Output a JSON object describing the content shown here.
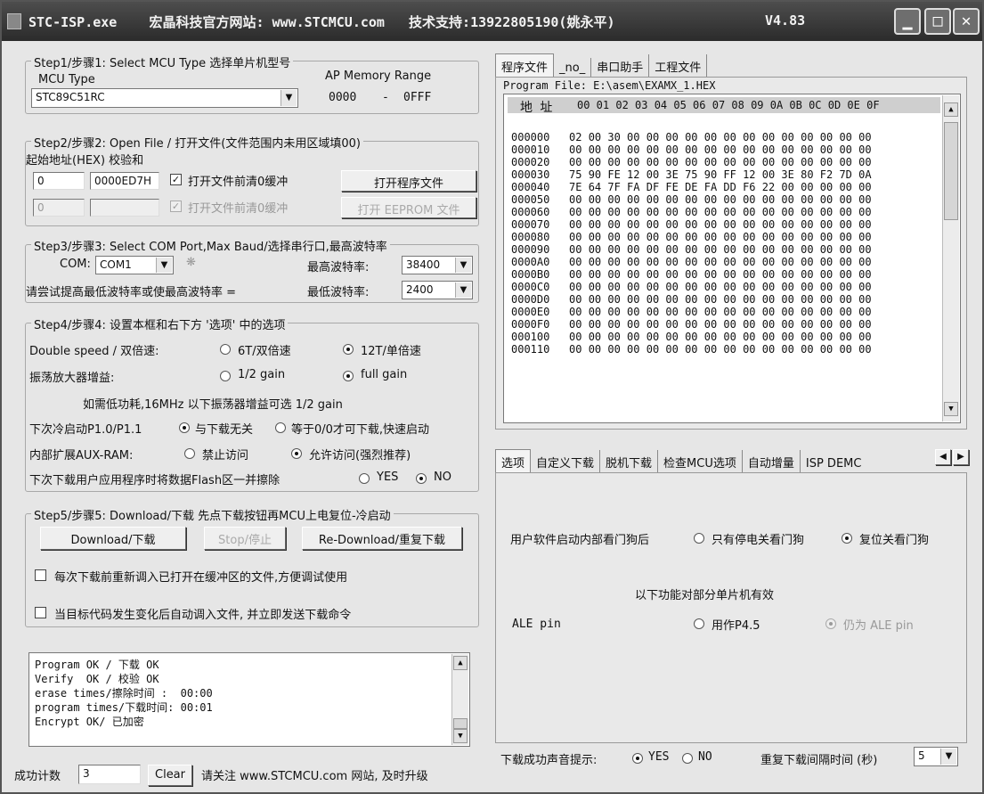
{
  "window": {
    "title": "STC-ISP.exe    宏晶科技官方网站: www.STCMCU.com   技术支持:13922805190(姚永平)",
    "version": "V4.83",
    "min_glyph": "▁",
    "max_glyph": "□",
    "close_glyph": "✕"
  },
  "step1": {
    "legend": "Step1/步骤1: Select MCU Type  选择单片机型号",
    "mcu_type_label": "MCU Type",
    "ap_memory_label": "AP Memory Range",
    "mcu_value": "STC89C51RC",
    "mem_start": "0000",
    "mem_dash": "-",
    "mem_end": "0FFF"
  },
  "step2": {
    "legend": "Step2/步骤2: Open File / 打开文件(文件范围内未用区域填00)",
    "start_addr_label": "起始地址(HEX) 校验和",
    "addr1": "0",
    "checksum1": "0000ED7H",
    "clear_buffer_label": "打开文件前清0缓冲",
    "open_program_button": "打开程序文件",
    "addr2": "0",
    "checksum2": "",
    "clear_buffer2_label": "打开文件前清0缓冲",
    "open_eeprom_button": "打开 EEPROM 文件"
  },
  "step3": {
    "legend": "Step3/步骤3: Select COM Port,Max Baud/选择串行口,最高波特率",
    "com_label": "COM:",
    "com_value": "COM1",
    "max_baud_label": "最高波特率:",
    "max_baud_value": "38400",
    "hint_label": "请尝试提高最低波特率或使最高波特率 =",
    "min_baud_label": "最低波特率:",
    "min_baud_value": "2400"
  },
  "step4": {
    "legend": "Step4/步骤4: 设置本框和右下方 '选项' 中的选项",
    "double_speed_label": "Double speed / 双倍速:",
    "opt_6t": "6T/双倍速",
    "opt_12t": "12T/单倍速",
    "osc_gain_label": "振荡放大器增益:",
    "opt_half_gain": "1/2 gain",
    "opt_full_gain": "full gain",
    "low_power_note": "如需低功耗,16MHz 以下振荡器增益可选 1/2 gain",
    "cold_boot_label": "下次冷启动P1.0/P1.1",
    "opt_unrelated": "与下载无关",
    "opt_00_only": "等于0/0才可下载,快速启动",
    "aux_ram_label": "内部扩展AUX-RAM:",
    "opt_no_access": "禁止访问",
    "opt_allow_access": "允许访问(强烈推荐)",
    "erase_flash_label": "下次下载用户应用程序时将数据Flash区一并擦除",
    "opt_yes": "YES",
    "opt_no": "NO"
  },
  "step5": {
    "legend": "Step5/步骤5: Download/下载  先点下载按钮再MCU上电复位-冷启动",
    "download_button": "Download/下载",
    "stop_button": "Stop/停止",
    "redownload_button": "Re-Download/重复下载",
    "reload_check_label": "每次下载前重新调入已打开在缓冲区的文件,方便调试使用",
    "auto_check_label": "当目标代码发生变化后自动调入文件, 并立即发送下载命令"
  },
  "log": [
    "Program OK / 下载 OK",
    "Verify  OK / 校验 OK",
    "erase times/擦除时间 :  00:00",
    "program times/下载时间: 00:01",
    "Encrypt OK/ 已加密"
  ],
  "footer": {
    "success_count_label": "成功计数",
    "success_count": "3",
    "clear_button": "Clear",
    "notice": "请关注 www.STCMCU.com 网站, 及时升级"
  },
  "top_tabs": [
    "程序文件",
    "_no_",
    "串口助手",
    "工程文件"
  ],
  "hex": {
    "file_legend": "Program File: E:\\asem\\EXAMX_1.HEX",
    "addr_header": "地 址",
    "col_header": "00 01 02 03 04 05 06 07 08 09 0A 0B 0C 0D 0E 0F",
    "rows": [
      "000000   02 00 30 00 00 00 00 00 00 00 00 00 00 00 00 00",
      "000010   00 00 00 00 00 00 00 00 00 00 00 00 00 00 00 00",
      "000020   00 00 00 00 00 00 00 00 00 00 00 00 00 00 00 00",
      "000030   75 90 FE 12 00 3E 75 90 FF 12 00 3E 80 F2 7D 0A",
      "000040   7E 64 7F FA DF FE DE FA DD F6 22 00 00 00 00 00",
      "000050   00 00 00 00 00 00 00 00 00 00 00 00 00 00 00 00",
      "000060   00 00 00 00 00 00 00 00 00 00 00 00 00 00 00 00",
      "000070   00 00 00 00 00 00 00 00 00 00 00 00 00 00 00 00",
      "000080   00 00 00 00 00 00 00 00 00 00 00 00 00 00 00 00",
      "000090   00 00 00 00 00 00 00 00 00 00 00 00 00 00 00 00",
      "0000A0   00 00 00 00 00 00 00 00 00 00 00 00 00 00 00 00",
      "0000B0   00 00 00 00 00 00 00 00 00 00 00 00 00 00 00 00",
      "0000C0   00 00 00 00 00 00 00 00 00 00 00 00 00 00 00 00",
      "0000D0   00 00 00 00 00 00 00 00 00 00 00 00 00 00 00 00",
      "0000E0   00 00 00 00 00 00 00 00 00 00 00 00 00 00 00 00",
      "0000F0   00 00 00 00 00 00 00 00 00 00 00 00 00 00 00 00",
      "000100   00 00 00 00 00 00 00 00 00 00 00 00 00 00 00 00",
      "000110   00 00 00 00 00 00 00 00 00 00 00 00 00 00 00 00"
    ]
  },
  "bottom_tabs": [
    "选项",
    "自定义下载",
    "脱机下载",
    "检查MCU选项",
    "自动增量",
    "ISP DEMC"
  ],
  "options": {
    "watchdog_label": "用户软件启动内部看门狗后",
    "opt_poweroff_watchdog": "只有停电关看门狗",
    "opt_reset_watchdog": "复位关看门狗",
    "partial_note": "以下功能对部分单片机有效",
    "ale_label": "ALE pin",
    "opt_as_p45": "用作P4.5",
    "opt_still_ale": "仍为 ALE pin",
    "sound_label": "下载成功声音提示:",
    "sound_yes": "YES",
    "sound_no": "NO",
    "repeat_interval_label": "重复下载间隔时间 (秒)",
    "repeat_interval_value": "5"
  }
}
